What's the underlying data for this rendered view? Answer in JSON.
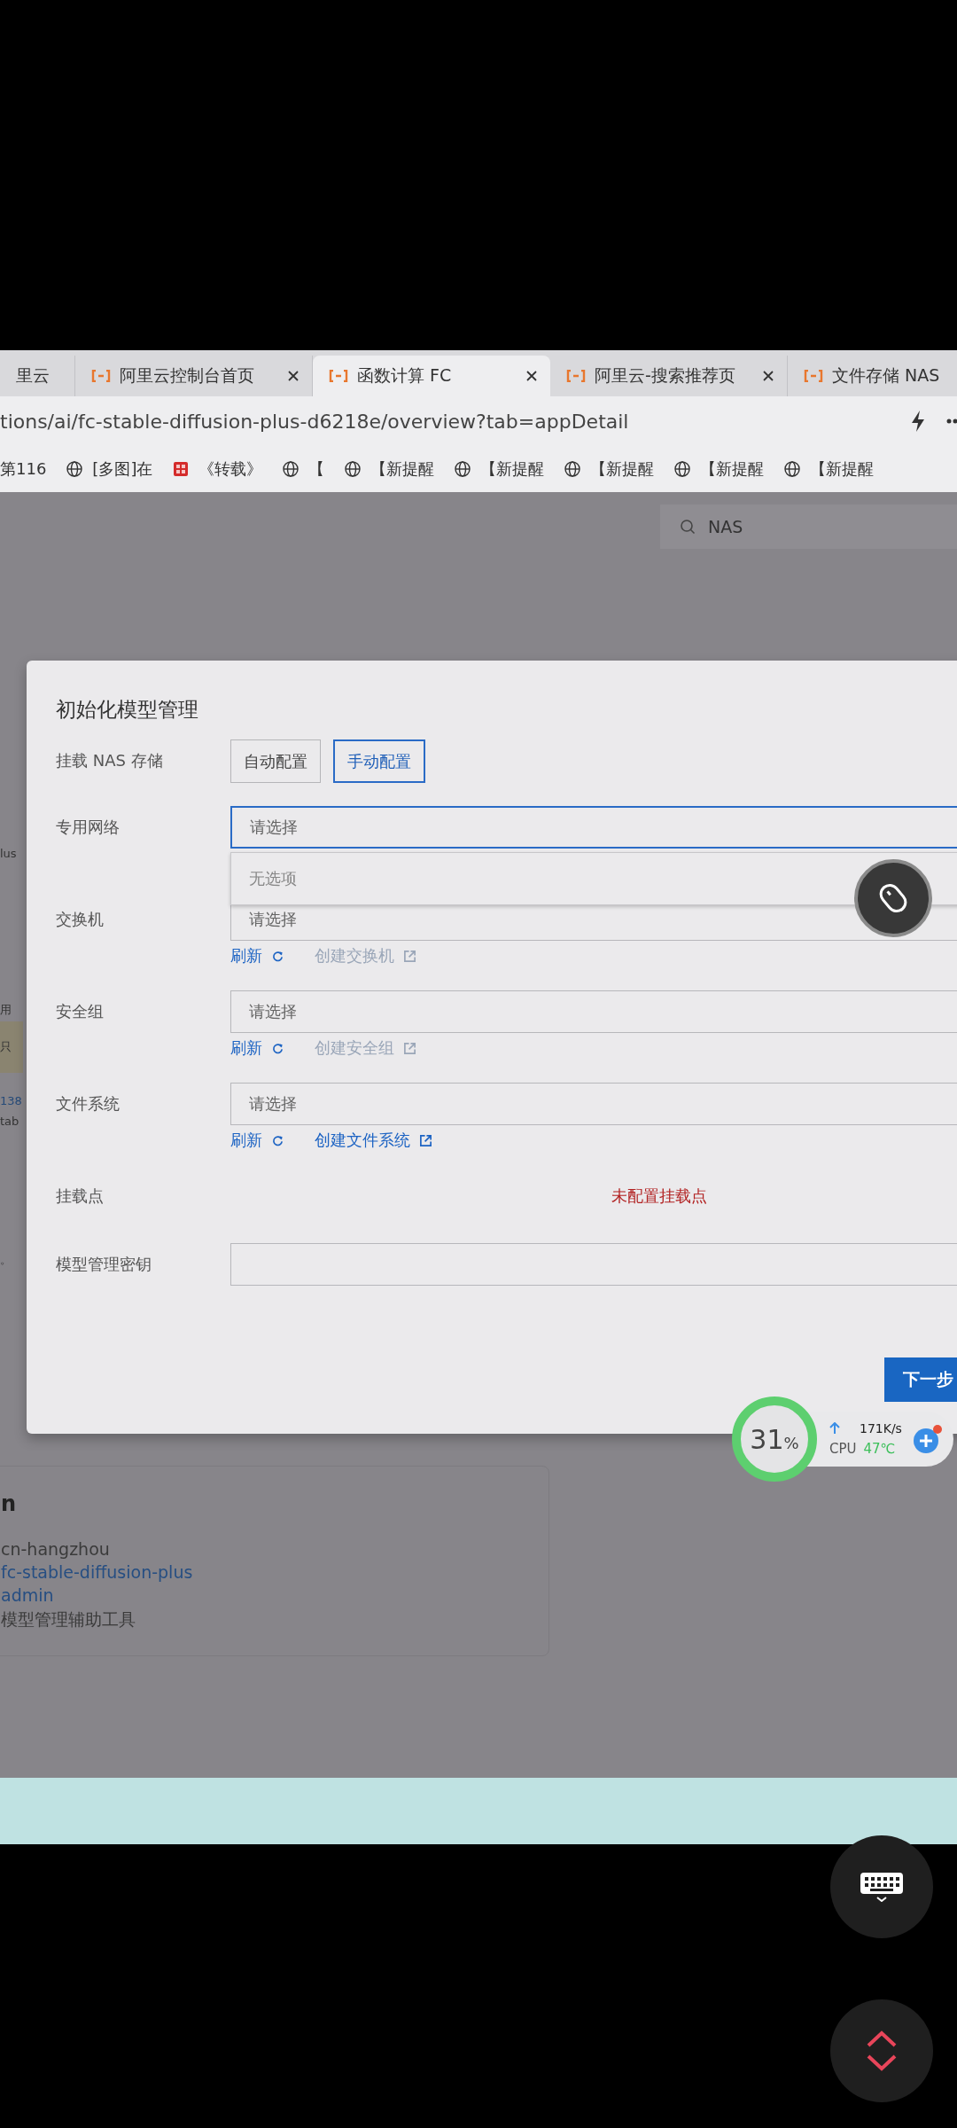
{
  "browser": {
    "tabs": [
      {
        "title": "里云",
        "selected": false
      },
      {
        "title": "阿里云控制台首页",
        "selected": false
      },
      {
        "title": "函数计算 FC",
        "selected": true
      },
      {
        "title": "阿里云-搜索推荐页",
        "selected": false
      },
      {
        "title": "文件存储 NAS",
        "selected": false
      }
    ],
    "address": "tions/ai/fc-stable-diffusion-plus-d6218e/overview?tab=appDetail",
    "bookmarks": [
      {
        "kind": "text",
        "label": "第116"
      },
      {
        "kind": "globe",
        "label": "[多图]在"
      },
      {
        "kind": "seal",
        "label": "《转载》"
      },
      {
        "kind": "globe",
        "label": "【"
      },
      {
        "kind": "globe",
        "label": "【新提醒"
      },
      {
        "kind": "globe",
        "label": "【新提醒"
      },
      {
        "kind": "globe",
        "label": "【新提醒"
      },
      {
        "kind": "globe",
        "label": "【新提醒"
      },
      {
        "kind": "globe",
        "label": "【新提醒"
      }
    ]
  },
  "page": {
    "search_value": "NAS",
    "fragments": [
      {
        "text": "lus",
        "kind": "plain"
      },
      {
        "text": "用",
        "kind": "plain"
      },
      {
        "text": "只",
        "kind": "notice"
      },
      {
        "text": "138",
        "kind": "link"
      },
      {
        "text": "tab",
        "kind": "plain"
      },
      {
        "text": "。",
        "kind": "plain"
      }
    ],
    "card": {
      "title": "n",
      "lines": [
        {
          "text": "cn-hangzhou",
          "kind": "plain"
        },
        {
          "text": "fc-stable-diffusion-plus",
          "kind": "link"
        },
        {
          "text": "admin",
          "kind": "link"
        },
        {
          "text": "模型管理辅助工具",
          "kind": "plain"
        }
      ]
    }
  },
  "dialog": {
    "title": "初始化模型管理",
    "rows": [
      {
        "kind": "choice",
        "label": "挂载 NAS 存储",
        "options": [
          {
            "label": "自动配置",
            "selected": false
          },
          {
            "label": "手动配置",
            "selected": true
          }
        ]
      },
      {
        "kind": "select",
        "label": "专用网络",
        "placeholder": "请选择",
        "focused": true,
        "dropdown": "无选项"
      },
      {
        "kind": "select",
        "label": "交换机",
        "placeholder": "请选择",
        "focused": false,
        "refresh": "刷新",
        "create": "创建交换机",
        "create_disabled": true
      },
      {
        "kind": "select",
        "label": "安全组",
        "placeholder": "请选择",
        "focused": false,
        "refresh": "刷新",
        "create": "创建安全组",
        "create_disabled": true
      },
      {
        "kind": "select",
        "label": "文件系统",
        "placeholder": "请选择",
        "focused": false,
        "refresh": "刷新",
        "create": "创建文件系统",
        "create_disabled": false
      },
      {
        "kind": "status",
        "label": "挂载点",
        "value": "未配置挂载点"
      },
      {
        "kind": "input",
        "label": "模型管理密钥"
      }
    ],
    "next_button": "下一步"
  },
  "monitor": {
    "percent": "31",
    "unit": "%",
    "speed": "171K/s",
    "cpu_label": "CPU",
    "temperature": "47℃"
  }
}
